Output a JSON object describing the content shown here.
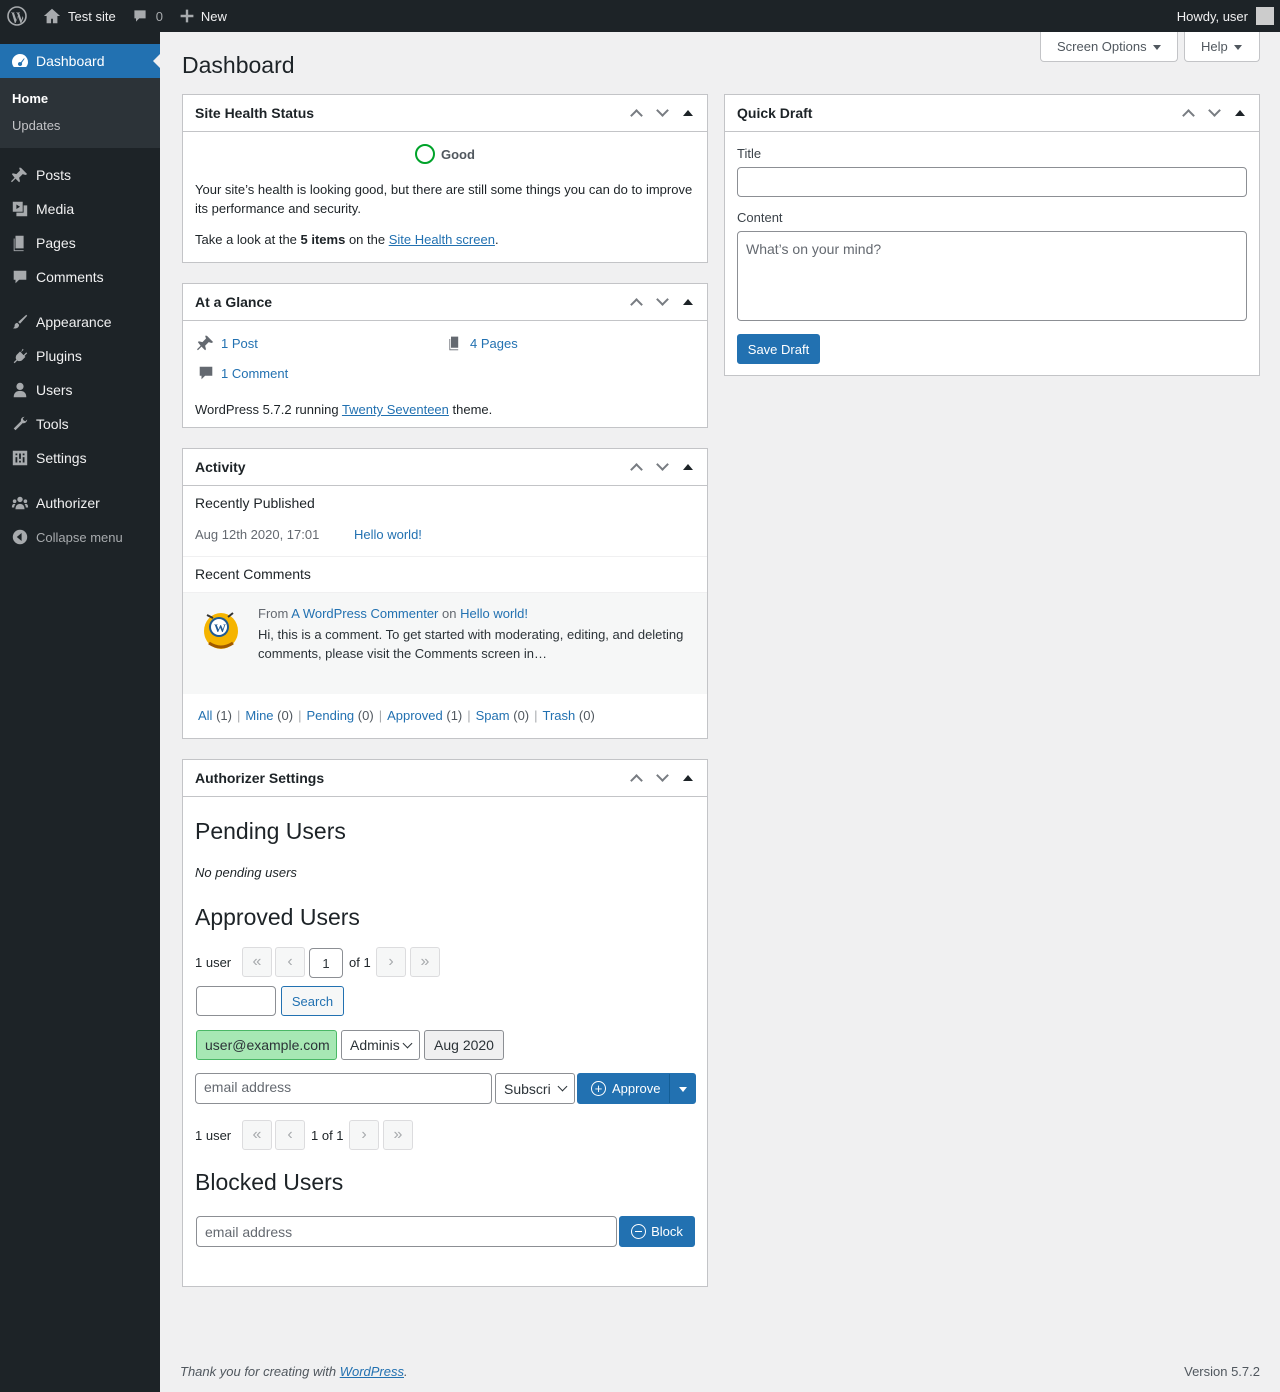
{
  "adminbar": {
    "site_name": "Test site",
    "comments_count": "0",
    "new_label": "New",
    "greeting": "Howdy, user"
  },
  "sidebar": {
    "dashboard": "Dashboard",
    "submenu": [
      "Home",
      "Updates"
    ],
    "items": [
      {
        "label": "Posts",
        "icon": "pin-icon"
      },
      {
        "label": "Media",
        "icon": "media-icon"
      },
      {
        "label": "Pages",
        "icon": "pages-icon"
      },
      {
        "label": "Comments",
        "icon": "comment-icon"
      },
      {
        "label": "Appearance",
        "icon": "brush-icon"
      },
      {
        "label": "Plugins",
        "icon": "plugin-icon"
      },
      {
        "label": "Users",
        "icon": "user-icon"
      },
      {
        "label": "Tools",
        "icon": "wrench-icon"
      },
      {
        "label": "Settings",
        "icon": "settings-icon"
      },
      {
        "label": "Authorizer",
        "icon": "group-icon"
      }
    ],
    "collapse": "Collapse menu"
  },
  "page": {
    "title": "Dashboard",
    "screen_options": "Screen Options",
    "help": "Help"
  },
  "site_health": {
    "title": "Site Health Status",
    "status": "Good",
    "message": "Your site’s health is looking good, but there are still some things you can do to improve its performance and security.",
    "take_look_pre": "Take a look at the ",
    "items_count": "5 items",
    "take_look_mid": " on the ",
    "link": "Site Health screen",
    "take_look_post": "."
  },
  "at_a_glance": {
    "title": "At a Glance",
    "posts": "1 Post",
    "pages": "4 Pages",
    "comments": "1 Comment",
    "wp_pre": "WordPress 5.7.2 running ",
    "theme": "Twenty Seventeen",
    "wp_post": " theme."
  },
  "activity": {
    "title": "Activity",
    "recently_published": "Recently Published",
    "post_date": "Aug 12th 2020, 17:01",
    "post_title": "Hello world!",
    "recent_comments": "Recent Comments",
    "from": "From",
    "commenter": "A WordPress Commenter",
    "on": "on",
    "comment_post": "Hello world!",
    "comment_text": "Hi, this is a comment. To get started with moderating, editing, and deleting comments, please visit the Comments screen in…",
    "filters": [
      {
        "label": "All",
        "count": "(1)"
      },
      {
        "label": "Mine",
        "count": "(0)"
      },
      {
        "label": "Pending",
        "count": "(0)"
      },
      {
        "label": "Approved",
        "count": "(1)"
      },
      {
        "label": "Spam",
        "count": "(0)"
      },
      {
        "label": "Trash",
        "count": "(0)"
      }
    ]
  },
  "authorizer": {
    "title": "Authorizer Settings",
    "pending_heading": "Pending Users",
    "no_pending": "No pending users",
    "approved_heading": "Approved Users",
    "user_count": "1 user",
    "page_input": "1",
    "of_pages": "of 1",
    "search_btn": "Search",
    "user_email": "user@example.com",
    "user_role": "Adminis",
    "user_date": "Aug 2020",
    "email_placeholder": "email address",
    "new_role": "Subscri",
    "approve_btn": "Approve",
    "bottom_count": "1 user",
    "bottom_pages": "1 of 1",
    "blocked_heading": "Blocked Users",
    "block_placeholder": "email address",
    "block_btn": "Block"
  },
  "quick_draft": {
    "title": "Quick Draft",
    "title_label": "Title",
    "content_label": "Content",
    "content_placeholder": "What’s on your mind?",
    "save_btn": "Save Draft"
  },
  "footer": {
    "thanks_pre": "Thank you for creating with ",
    "wp_link": "WordPress",
    "thanks_post": ".",
    "version": "Version 5.7.2"
  }
}
